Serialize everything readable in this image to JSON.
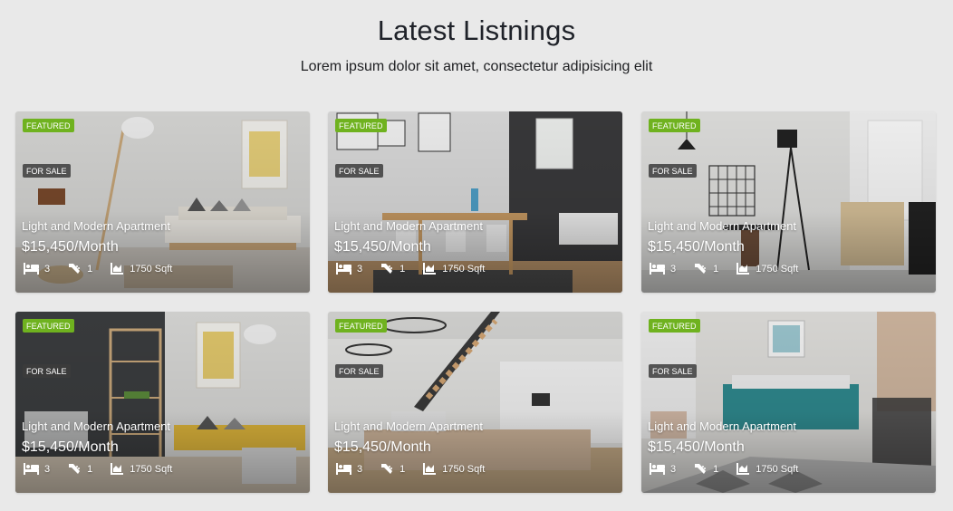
{
  "section": {
    "title": "Latest Listnings",
    "subtitle": "Lorem ipsum dolor sit amet, consectetur adipisicing elit"
  },
  "listings": [
    {
      "featured": "FEATURED",
      "status": "FOR SALE",
      "title": "Light and Modern Apartment",
      "price": "$15,450/Month",
      "beds": "3",
      "baths": "1",
      "area": "1750 Sqft"
    },
    {
      "featured": "FEATURED",
      "status": "FOR SALE",
      "title": "Light and Modern Apartment",
      "price": "$15,450/Month",
      "beds": "3",
      "baths": "1",
      "area": "1750 Sqft"
    },
    {
      "featured": "FEATURED",
      "status": "FOR SALE",
      "title": "Light and Modern Apartment",
      "price": "$15,450/Month",
      "beds": "3",
      "baths": "1",
      "area": "1750 Sqft"
    },
    {
      "featured": "FEATURED",
      "status": "FOR SALE",
      "title": "Light and Modern Apartment",
      "price": "$15,450/Month",
      "beds": "3",
      "baths": "1",
      "area": "1750 Sqft"
    },
    {
      "featured": "FEATURED",
      "status": "FOR SALE",
      "title": "Light and Modern Apartment",
      "price": "$15,450/Month",
      "beds": "3",
      "baths": "1",
      "area": "1750 Sqft"
    },
    {
      "featured": "FEATURED",
      "status": "FOR SALE",
      "title": "Light and Modern Apartment",
      "price": "$15,450/Month",
      "beds": "3",
      "baths": "1",
      "area": "1750 Sqft"
    }
  ],
  "icons": {
    "beds": "bed-icon",
    "baths": "bath-icon",
    "area": "area-chart-icon"
  },
  "colors": {
    "featured_badge": "#6fb21f",
    "sale_badge": "#3c3c3c",
    "page_background": "#e9e9e9"
  }
}
